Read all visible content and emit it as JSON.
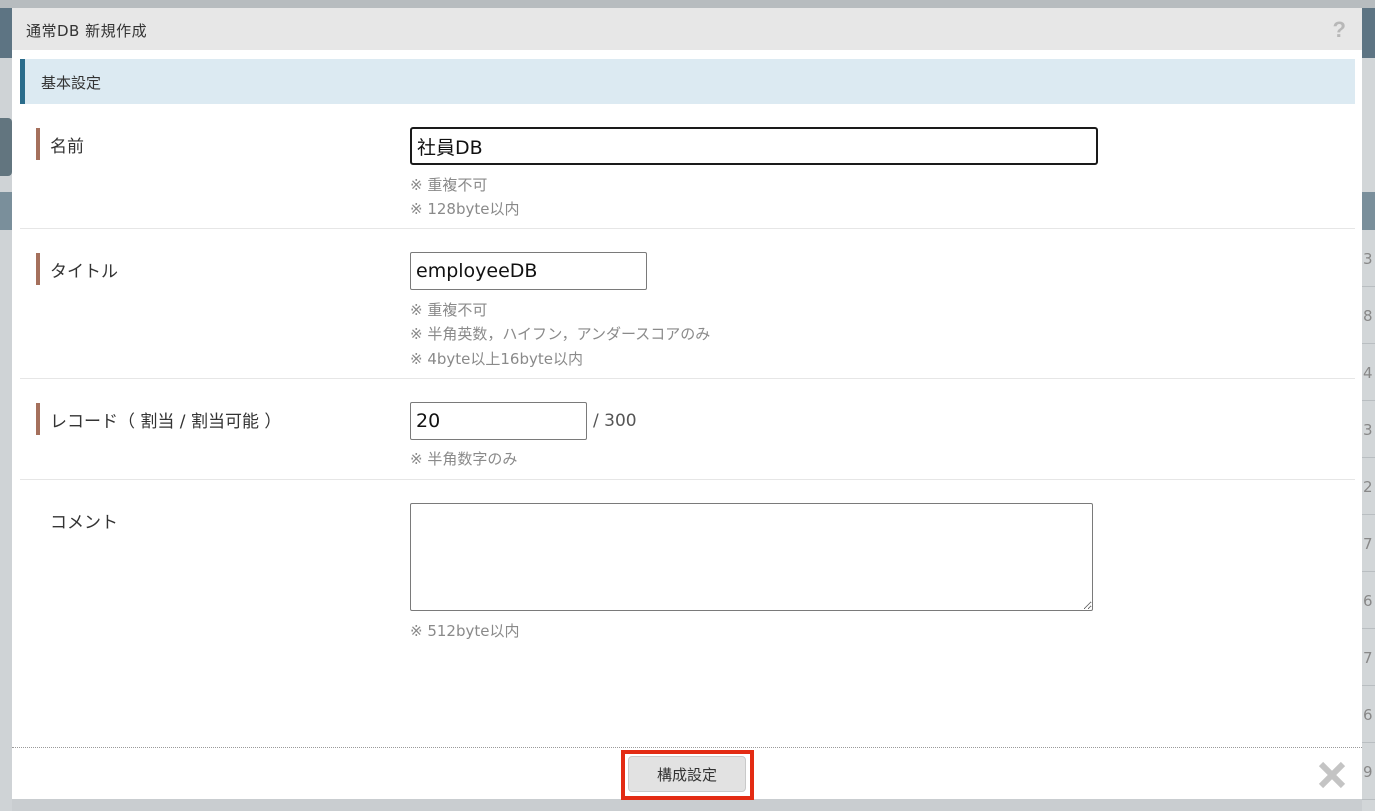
{
  "dialog": {
    "title": "通常DB 新規作成",
    "help_icon": "?"
  },
  "section": {
    "title": "基本設定"
  },
  "fields": {
    "name": {
      "label": "名前",
      "value": "社員DB",
      "notes": [
        "※ 重複不可",
        "※ 128byte以内"
      ]
    },
    "title": {
      "label": "タイトル",
      "value": "employeeDB",
      "notes": [
        "※ 重複不可",
        "※ 半角英数，ハイフン，アンダースコアのみ",
        "※ 4byte以上16byte以内"
      ]
    },
    "record": {
      "label": "レコード（ 割当 / 割当可能 ）",
      "value": "20",
      "suffix": "/ 300",
      "notes": [
        "※ 半角数字のみ"
      ]
    },
    "comment": {
      "label": "コメント",
      "value": "",
      "notes": [
        "※ 512byte以内"
      ]
    }
  },
  "footer": {
    "primary_button_label": "構成設定",
    "close_icon": "close-icon"
  },
  "background_peek": {
    "right_column_digits": [
      "3",
      "8",
      "4",
      "3",
      "2",
      "7",
      "6",
      "7",
      "6",
      "9"
    ]
  },
  "colors": {
    "section_accent": "#2a6c8b",
    "label_bar": "#a5705c",
    "highlight": "#e32b13"
  }
}
